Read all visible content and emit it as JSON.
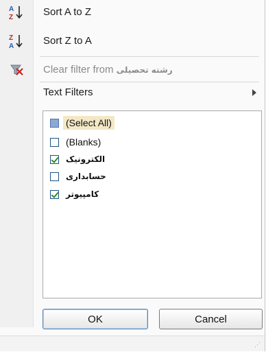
{
  "menu": {
    "sort_az": {
      "label": "Sort A to Z",
      "icon": "sort-ascending-icon"
    },
    "sort_za": {
      "label": "Sort Z to A",
      "icon": "sort-descending-icon"
    },
    "clear_filter": {
      "label": "Clear filter from ",
      "field": "رشته تحصیلی",
      "icon": "clear-filter-icon",
      "disabled": true
    },
    "text_filters": {
      "label": "Text Filters"
    }
  },
  "list": {
    "items": [
      {
        "label": "(Select All)",
        "state": "indeterminate"
      },
      {
        "label": "(Blanks)",
        "state": "unchecked"
      },
      {
        "label": "الکترونیک",
        "state": "checked"
      },
      {
        "label": "حسابداری",
        "state": "unchecked"
      },
      {
        "label": "کامپیوتر",
        "state": "checked"
      }
    ]
  },
  "buttons": {
    "ok": "OK",
    "cancel": "Cancel"
  },
  "colors": {
    "check": "#2b8a2b",
    "indeterminate": "#8ba9d4",
    "highlight": "#f2e8c6"
  }
}
